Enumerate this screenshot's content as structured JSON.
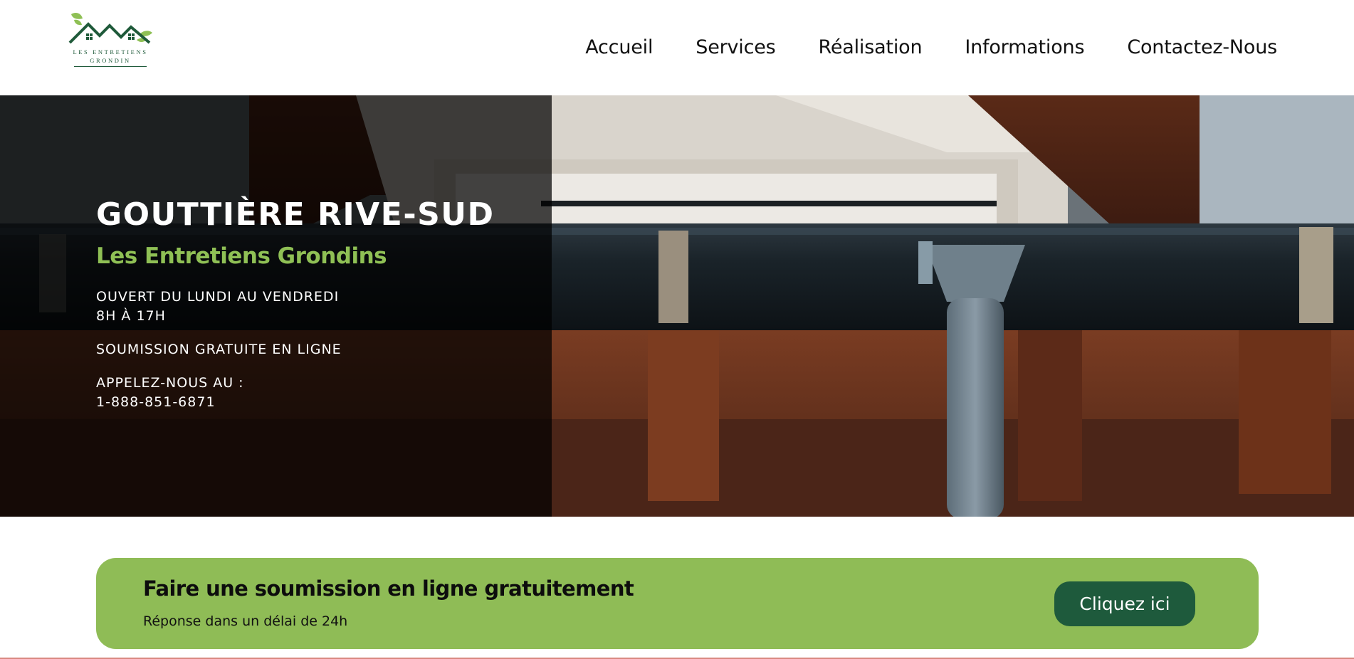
{
  "header": {
    "logo": {
      "line1": "LES ENTRETIENS",
      "line2": "GRONDIN",
      "icon": "house-leaves-logo",
      "color": "#1f5a3a"
    },
    "nav": [
      {
        "label": "Accueil"
      },
      {
        "label": "Services"
      },
      {
        "label": "Réalisation"
      },
      {
        "label": "Informations"
      },
      {
        "label": "Contactez-Nous"
      }
    ]
  },
  "hero": {
    "title": "GOUTTIÈRE RIVE-SUD",
    "subtitle": "Les Entretiens Grondins",
    "hours_line1": "OUVERT DU LUNDI AU VENDREDI",
    "hours_line2": "8H À 17H",
    "quote": "SOUMISSION GRATUITE EN LIGNE",
    "call_label": "APPELEZ-NOUS AU :",
    "phone": "1-888-851-6871",
    "accent_color": "#8fc055"
  },
  "cta": {
    "title": "Faire une soumission en ligne gratuitement",
    "subtitle": "Réponse dans un délai de 24h",
    "button_label": "Cliquez ici",
    "background": "#8fbc56",
    "button_color": "#1e5a3c"
  }
}
